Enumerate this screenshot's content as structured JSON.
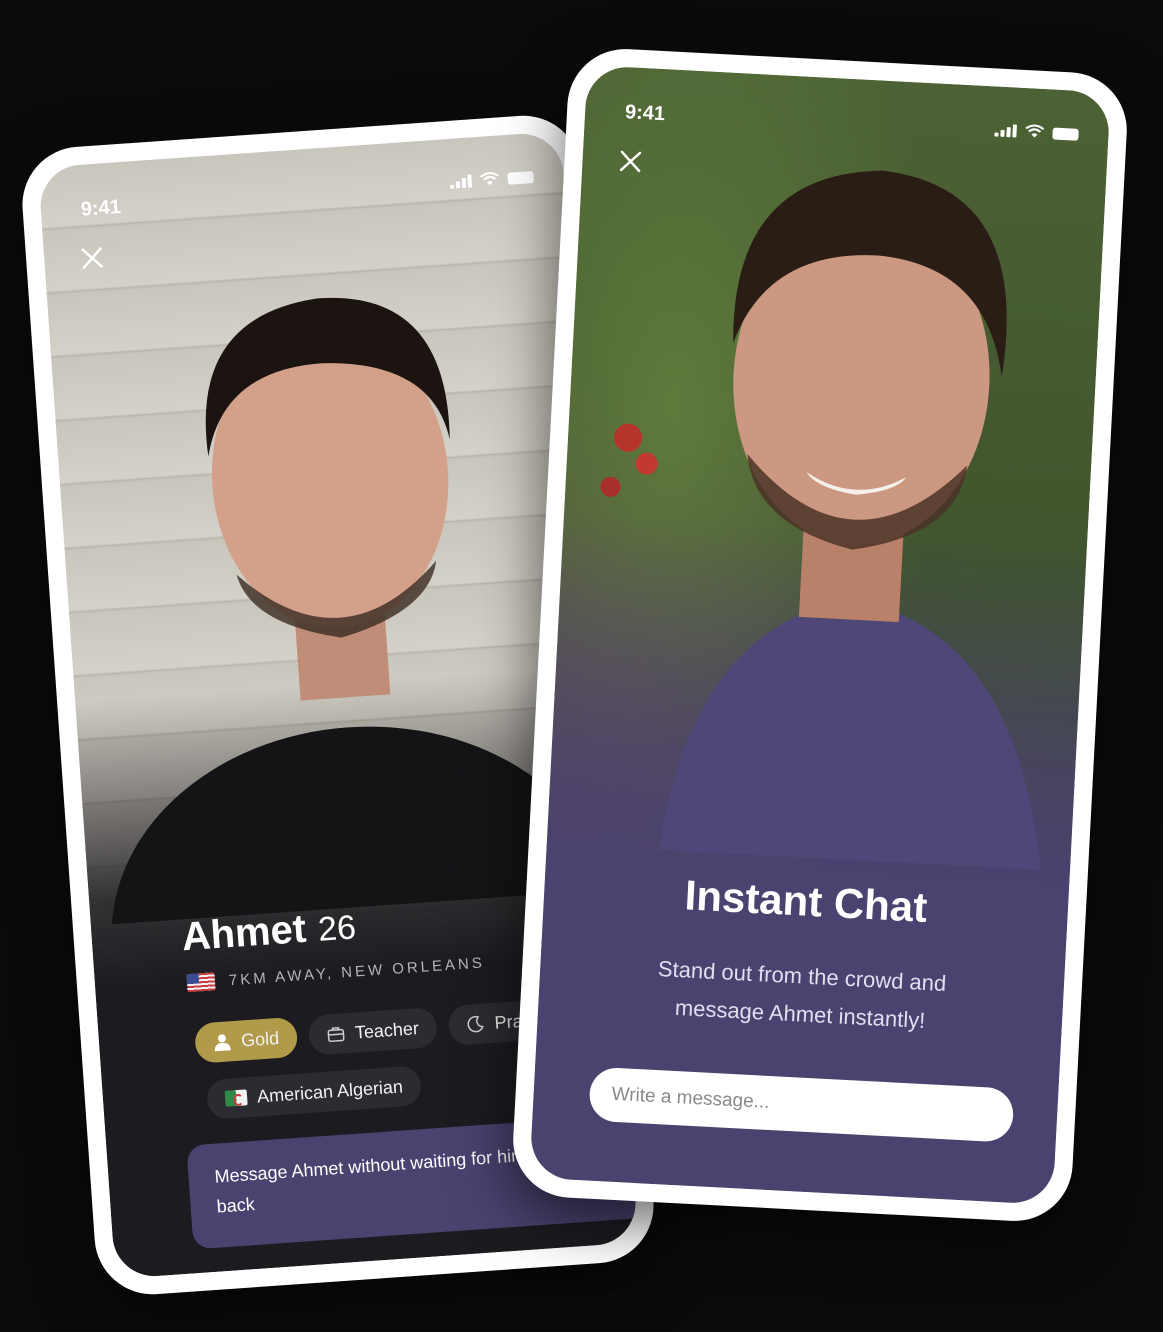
{
  "left_screen": {
    "time": "9:41",
    "name": "Ahmet",
    "age": "26",
    "location": "7KM AWAY, NEW ORLEANS",
    "chips": {
      "gold": "Gold",
      "job": "Teacher",
      "religion": "Prac",
      "nationality": "American Algerian"
    },
    "promo": "Message Ahmet without waiting for him to Like you back"
  },
  "right_screen": {
    "time": "9:41",
    "title": "Instant Chat",
    "subtitle_line1": "Stand out from the crowd and",
    "subtitle_line2": "message Ahmet instantly!",
    "input_placeholder": "Write a message..."
  },
  "colors": {
    "background": "#0b0b0d",
    "accent_purple": "#4b4270",
    "gold": "#b19a4a",
    "chip_dark": "#2c2b31"
  },
  "icons": [
    "close-icon",
    "signal-icon",
    "wifi-icon",
    "battery-icon",
    "user-icon",
    "briefcase-icon",
    "moon-icon",
    "us-flag-icon",
    "algeria-flag-icon"
  ]
}
